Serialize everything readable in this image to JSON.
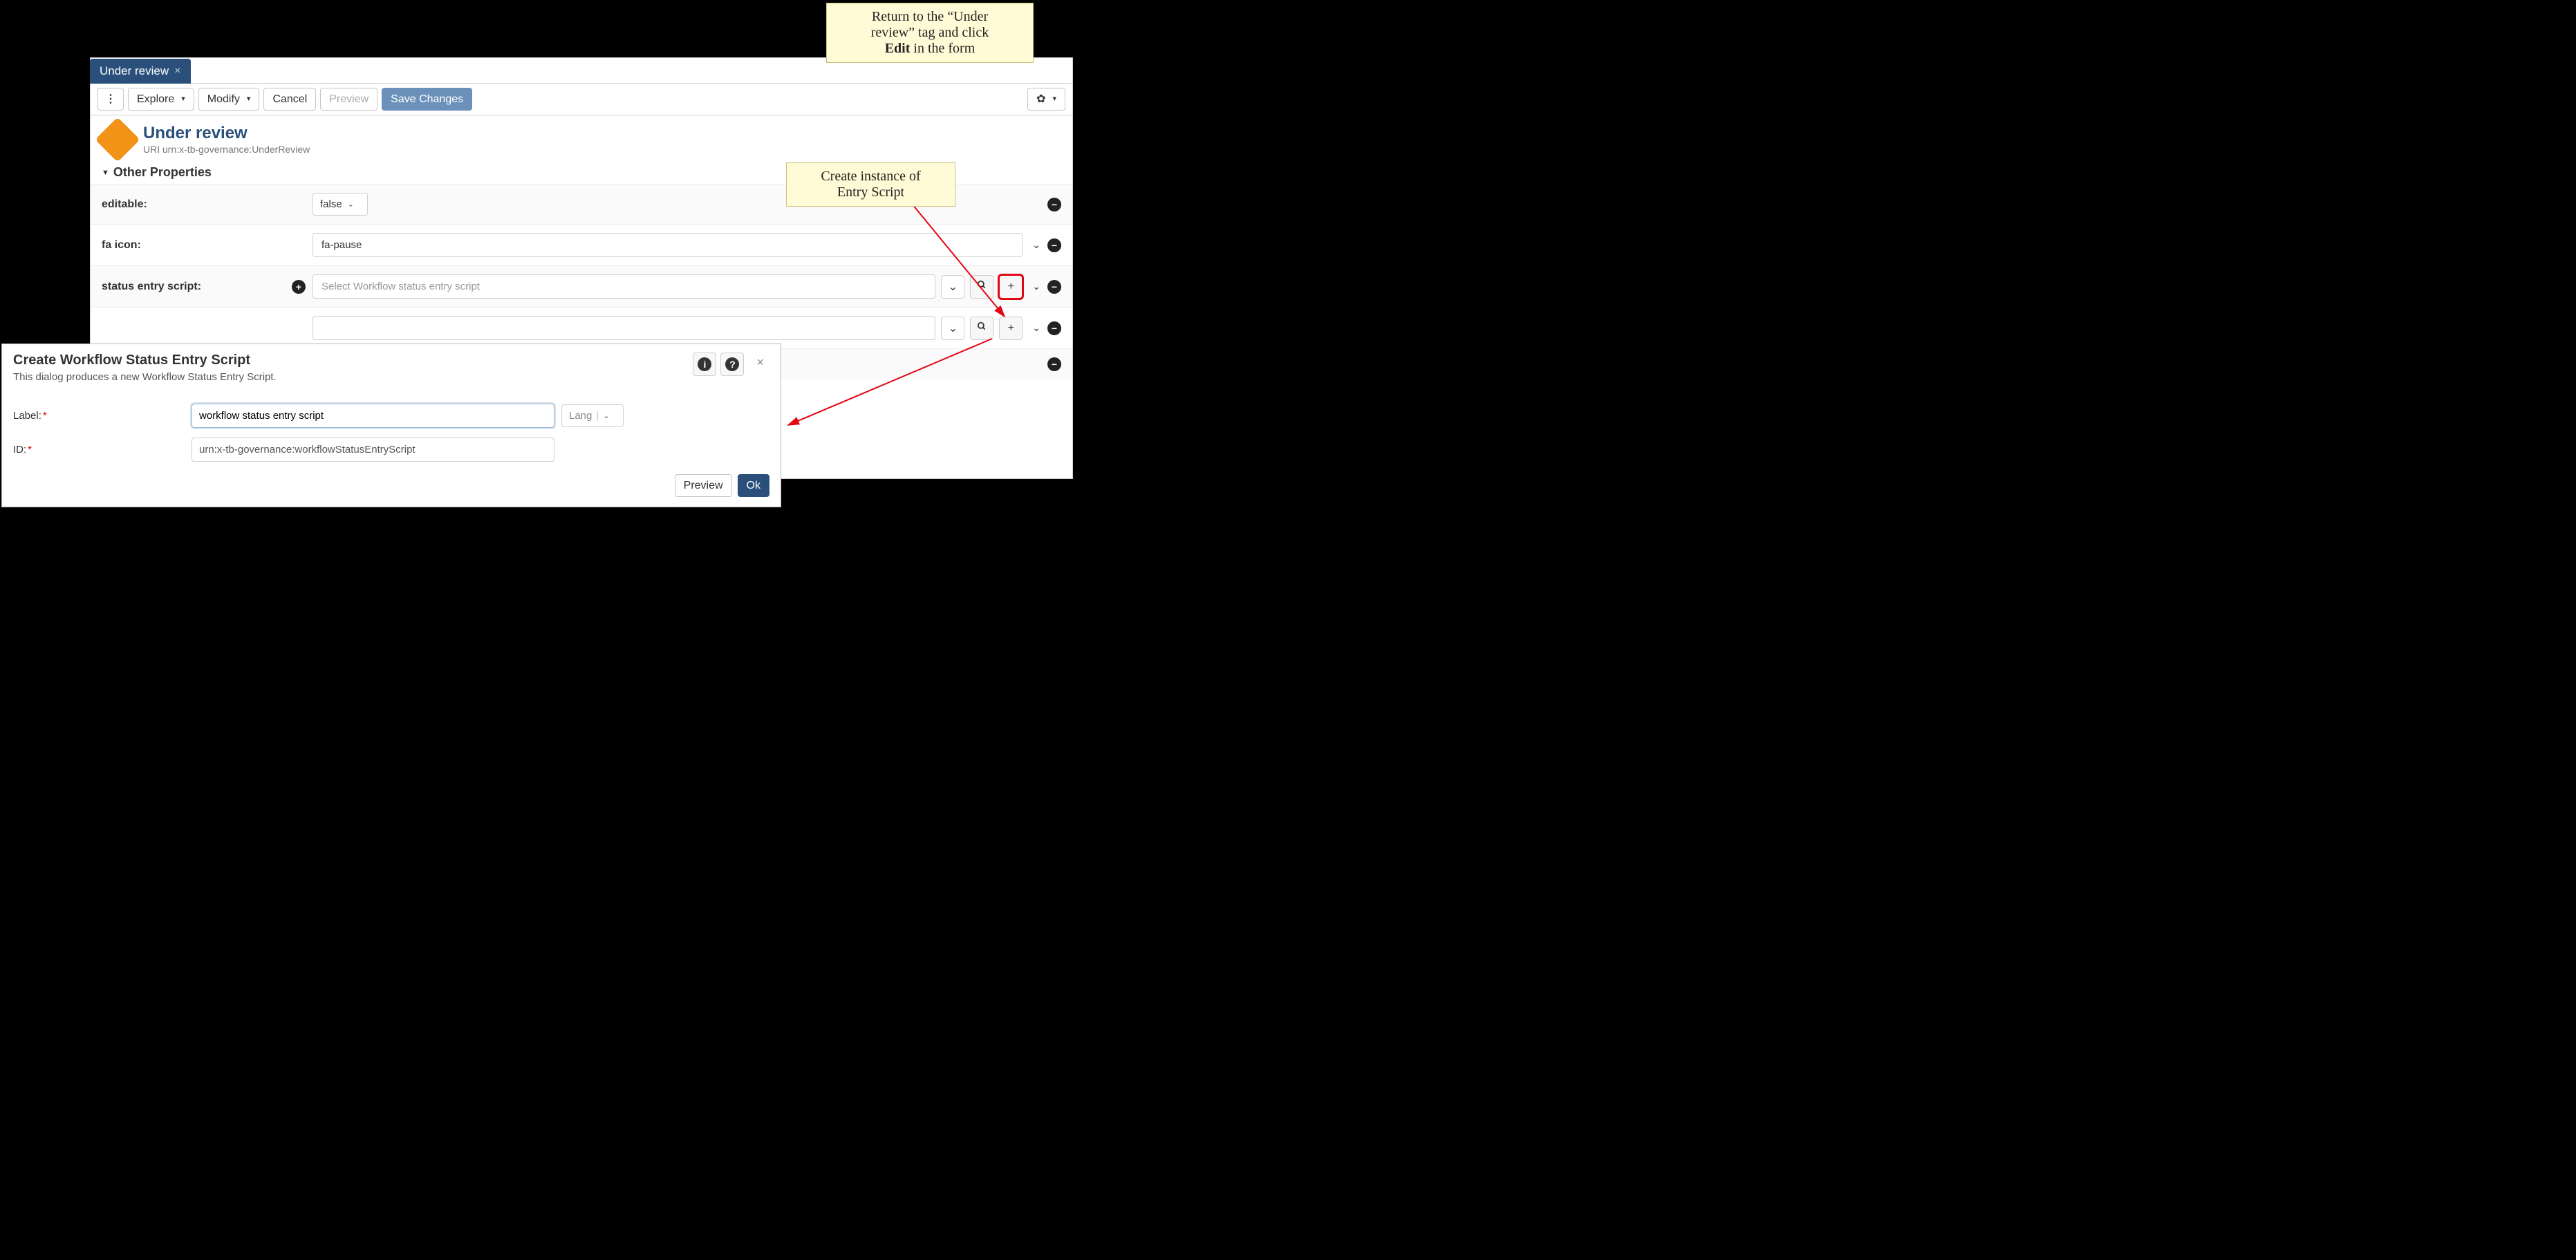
{
  "tab": {
    "label": "Under review"
  },
  "toolbar": {
    "more": "⋮",
    "explore": "Explore",
    "modify": "Modify",
    "cancel": "Cancel",
    "preview": "Preview",
    "save": "Save Changes"
  },
  "entity": {
    "title": "Under review",
    "uri_label": "URI",
    "uri": "urn:x-tb-governance:UnderReview"
  },
  "section": {
    "other_props": "Other Properties"
  },
  "props": {
    "editable_label": "editable:",
    "editable_value": "false",
    "fa_icon_label": "fa icon:",
    "fa_icon_value": "fa-pause",
    "entry_script_label": "status entry script:",
    "entry_script_placeholder": "Select Workflow status entry script",
    "row2_placeholder": ""
  },
  "dialog": {
    "title": "Create Workflow Status Entry Script",
    "subtitle": "This dialog produces a new Workflow Status Entry Script.",
    "label_label": "Label:",
    "label_value": "workflow status entry script",
    "lang_placeholder": "Lang",
    "id_label": "ID:",
    "id_value": "urn:x-tb-governance:workflowStatusEntryScript",
    "preview": "Preview",
    "ok": "Ok"
  },
  "callouts": {
    "c1_line1": "Return to the “Under",
    "c1_line2": "review” tag and click",
    "c1_line3_bold": "Edit",
    "c1_line3_rest": " in the form",
    "c2_line1": "Create instance of",
    "c2_line2": "Entry Script"
  }
}
